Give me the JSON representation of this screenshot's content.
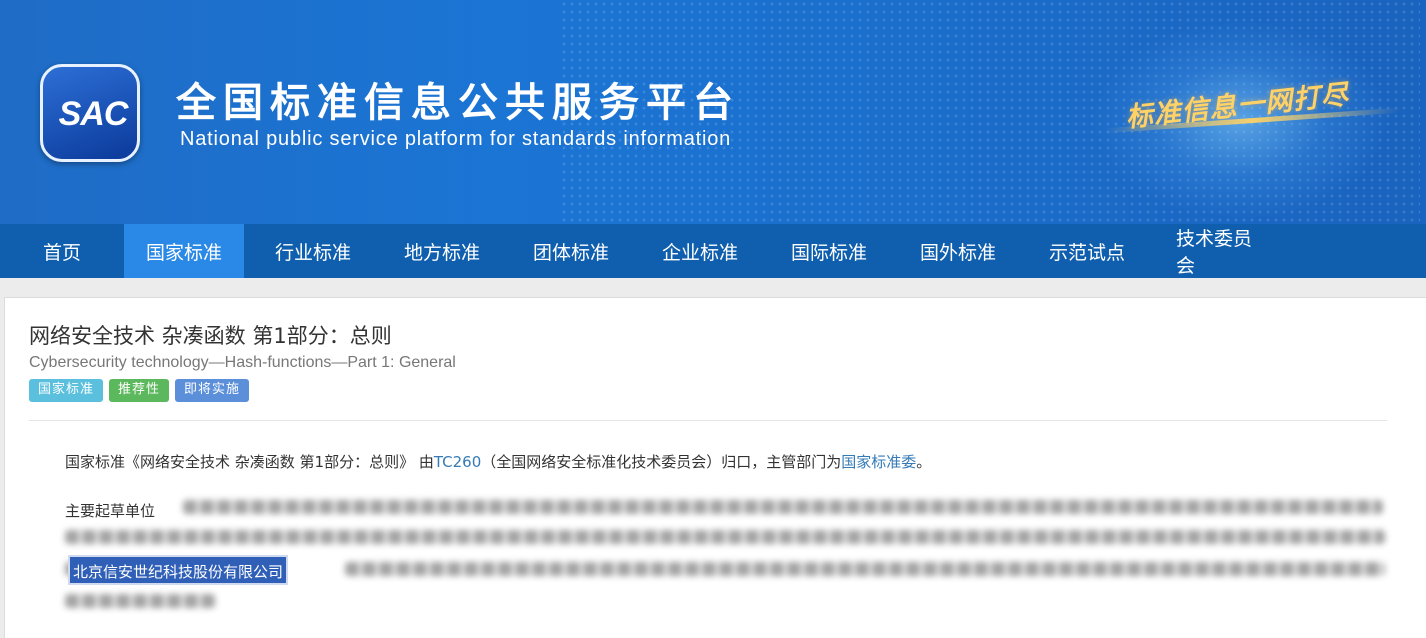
{
  "header": {
    "logo_text": "SAC",
    "title": "全国标准信息公共服务平台",
    "subtitle": "National public service platform  for standards information",
    "slogan": "标准信息一网打尽"
  },
  "nav": {
    "items": [
      "首页",
      "国家标准",
      "行业标准",
      "地方标准",
      "团体标准",
      "企业标准",
      "国际标准",
      "国外标准",
      "示范试点",
      "技术委员会"
    ],
    "active_index": 1
  },
  "standard": {
    "title_cn": "网络安全技术 杂凑函数 第1部分：总则",
    "title_en": "Cybersecurity technology—Hash-functions—Part 1: General",
    "badges": [
      "国家标准",
      "推荐性",
      "即将实施"
    ],
    "intro_prefix": "国家标准《网络安全技术 杂凑函数 第1部分：总则》 由",
    "committee_link": "TC260",
    "intro_middle": "（全国网络安全标准化技术委员会）归口，主管部门为",
    "authority_link": "国家标准委",
    "intro_suffix": "。",
    "drafters_label": "主要起草单位",
    "highlighted_drafter": "北京信安世纪科技股份有限公司"
  },
  "colors": {
    "nav_bg": "#0f5fae",
    "nav_active": "#2a88e6",
    "badge_national": "#5bc0de",
    "badge_recommended": "#5cb85c",
    "badge_upcoming": "#5b8fd9",
    "link": "#337ab7",
    "highlight": "#2f5fb6"
  }
}
